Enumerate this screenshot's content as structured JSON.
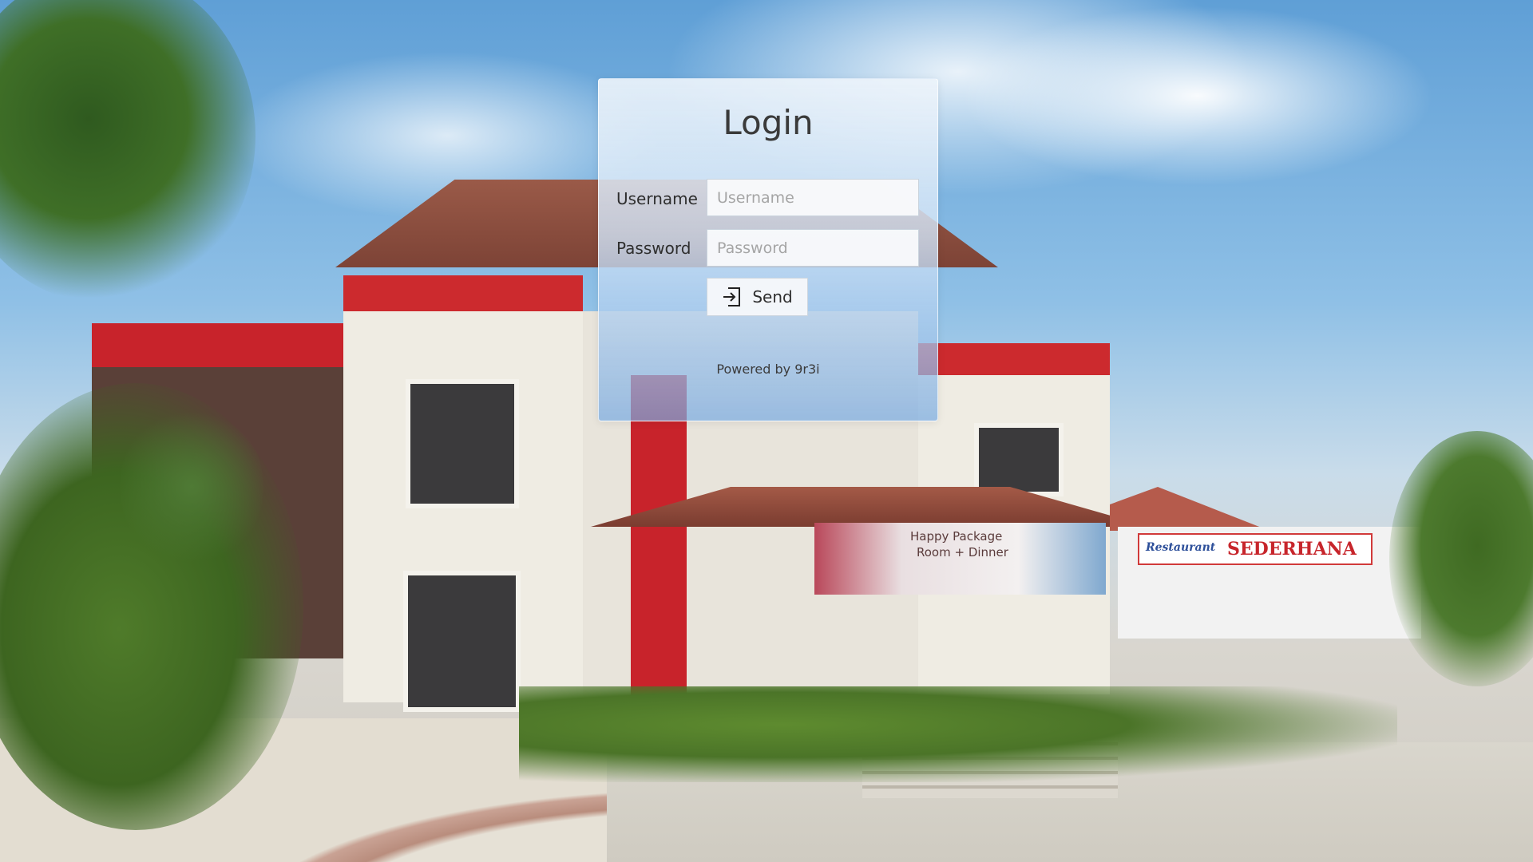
{
  "login": {
    "title": "Login",
    "username_label": "Username",
    "username_placeholder": "Username",
    "username_value": "",
    "password_label": "Password",
    "password_placeholder": "Password",
    "password_value": "",
    "send_label": "Send",
    "send_icon": "sign-in-icon",
    "footer": "Powered by 9r3i"
  },
  "background": {
    "banner_heading": "Happy Package",
    "banner_subheading": "Room + Dinner",
    "restaurant_sign": "SEDERHANA",
    "restaurant_sign_prefix": "Restaurant"
  }
}
